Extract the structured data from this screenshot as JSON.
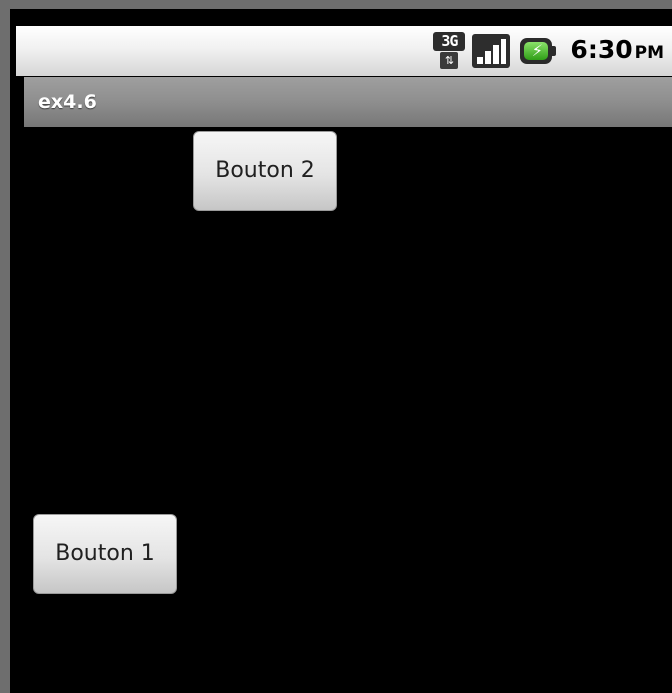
{
  "status_bar": {
    "network_type": "3G",
    "data_arrows": "⇅",
    "signal_bars": 4,
    "battery_icon": "battery-charging-icon",
    "time": "6:30",
    "ampm": "PM"
  },
  "app_bar": {
    "title": "ex4.6"
  },
  "buttons": {
    "button2_label": "Bouton 2",
    "button1_label": "Bouton 1"
  },
  "colors": {
    "screen_background": "#000000",
    "title_bar": "#8e8e8e",
    "battery_green": "#2f9e17"
  }
}
